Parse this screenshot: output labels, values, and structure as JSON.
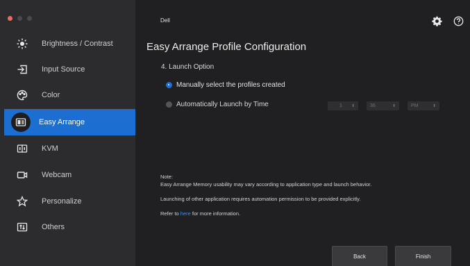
{
  "app_title": "Dell",
  "sidebar": {
    "items": [
      {
        "label": "Brightness / Contrast",
        "icon": "brightness-icon"
      },
      {
        "label": "Input Source",
        "icon": "input-source-icon"
      },
      {
        "label": "Color",
        "icon": "color-icon"
      },
      {
        "label": "Easy Arrange",
        "icon": "easy-arrange-icon",
        "active": true
      },
      {
        "label": "KVM",
        "icon": "kvm-icon"
      },
      {
        "label": "Webcam",
        "icon": "webcam-icon"
      },
      {
        "label": "Personalize",
        "icon": "star-icon"
      },
      {
        "label": "Others",
        "icon": "others-icon"
      }
    ]
  },
  "main": {
    "title": "Easy Arrange Profile Configuration",
    "section": "4. Launch Option",
    "options": [
      {
        "label": "Manually select the profiles created",
        "selected": true
      },
      {
        "label": "Automatically Launch by Time",
        "selected": false
      }
    ],
    "time": {
      "hour": "1",
      "minute": "36",
      "period": "PM"
    },
    "note": {
      "heading": "Note:",
      "line1": "Easy Arrange Memory usability may vary according to application type and launch behavior.",
      "line2": "Launching of other application requires automation permission to be provided explicitly.",
      "refer_prefix": "Refer to",
      "refer_link": "here",
      "refer_suffix": "for more information."
    },
    "buttons": {
      "back": "Back",
      "finish": "Finish"
    }
  },
  "colors": {
    "accent": "#1c6fd1",
    "link": "#3d8bff"
  }
}
